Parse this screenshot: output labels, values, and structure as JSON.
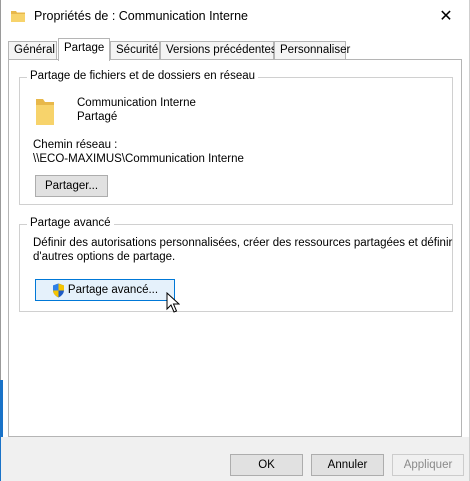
{
  "window": {
    "title": "Propriétés de : Communication Interne",
    "close_glyph": "✕"
  },
  "tabs": [
    {
      "label": "Général",
      "active": false
    },
    {
      "label": "Partage",
      "active": true
    },
    {
      "label": "Sécurité",
      "active": false
    },
    {
      "label": "Versions précédentes",
      "active": false
    },
    {
      "label": "Personnaliser",
      "active": false
    }
  ],
  "network_sharing": {
    "group_title": "Partage de fichiers et de dossiers en réseau",
    "folder_name": "Communication Interne",
    "folder_state": "Partagé",
    "path_label": "Chemin réseau :",
    "path_value": "\\\\ECO-MAXIMUS\\Communication Interne",
    "share_button": "Partager..."
  },
  "advanced_sharing": {
    "group_title": "Partage avancé",
    "description_line1": "Définir des autorisations personnalisées, créer des ressources partagées et définir",
    "description_line2": "d'autres options de partage.",
    "button": "Partage avancé..."
  },
  "footer": {
    "ok": "OK",
    "cancel": "Annuler",
    "apply": "Appliquer"
  },
  "icons": {
    "title": "folder-icon",
    "folder": "folder-icon",
    "shield": "uac-shield-icon",
    "cursor": "mouse-pointer-icon"
  },
  "colors": {
    "accent": "#0078d7",
    "folder": "#f7d36b"
  }
}
